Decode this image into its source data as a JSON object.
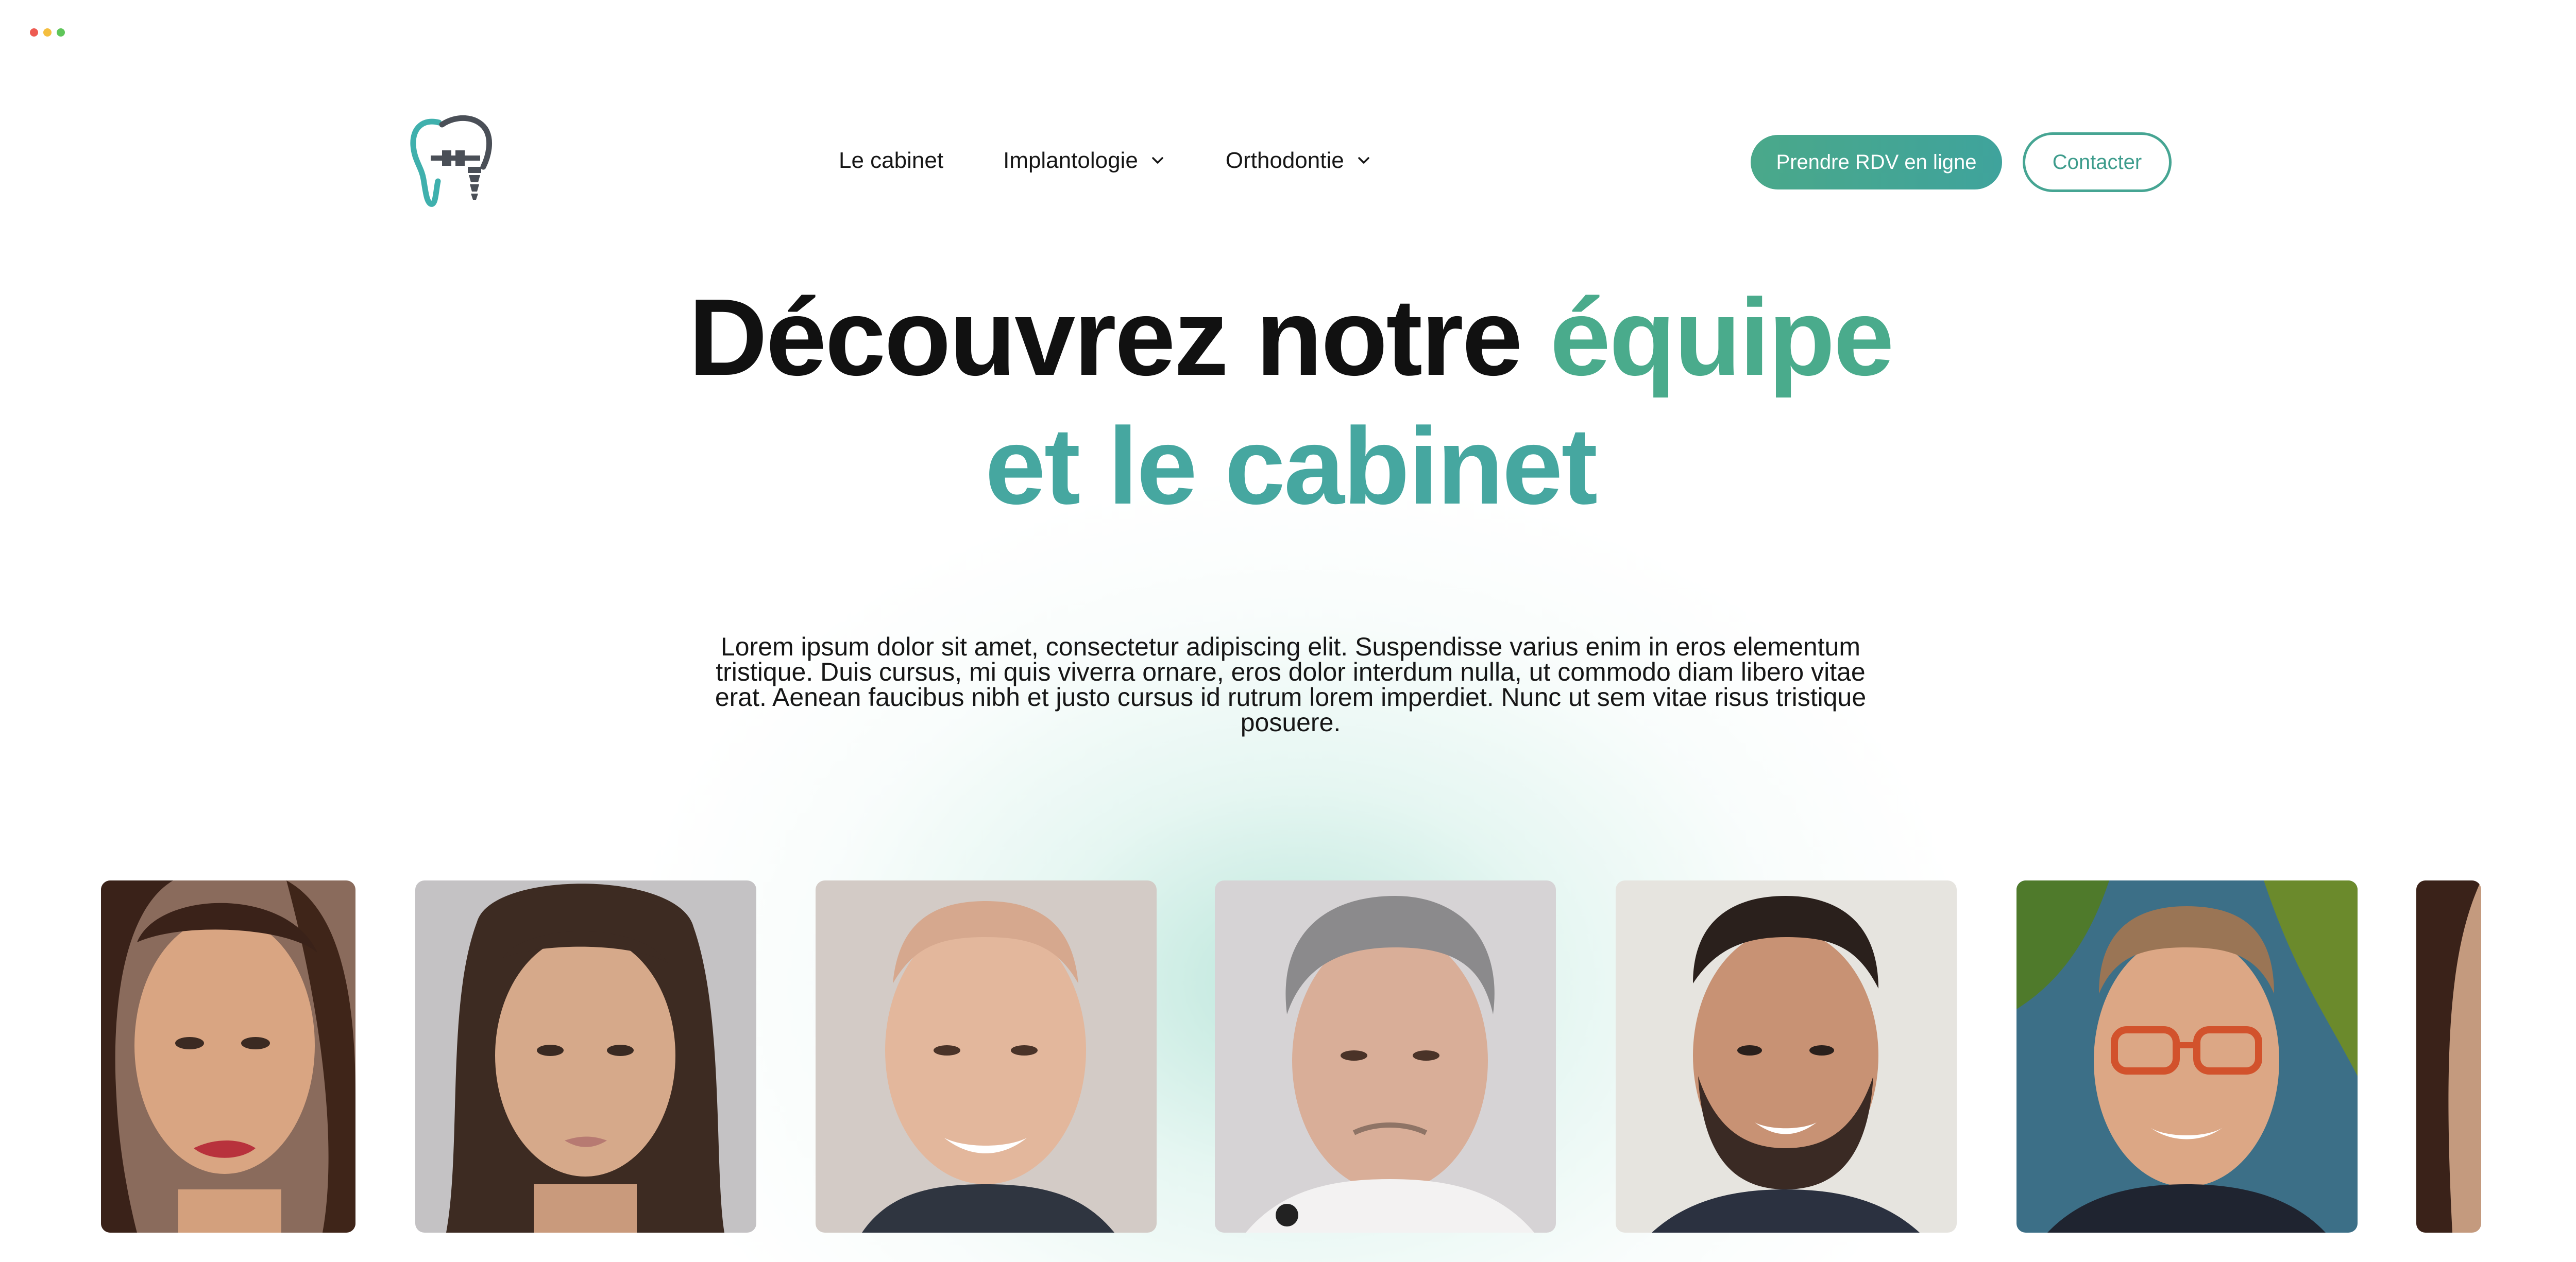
{
  "window": {
    "dots": [
      "#ee5b52",
      "#f4be3f",
      "#5fc65a"
    ]
  },
  "brand": {
    "logo_icon": "tooth-implant-logo-icon",
    "colors": {
      "green": "#4aab8c",
      "teal": "#46a7a0",
      "text": "#111111"
    }
  },
  "nav": {
    "items": [
      {
        "label": "Le cabinet",
        "has_dropdown": false
      },
      {
        "label": "Implantologie",
        "has_dropdown": true,
        "icon": "chevron-down-icon"
      },
      {
        "label": "Orthodontie",
        "has_dropdown": true,
        "icon": "chevron-down-icon"
      }
    ],
    "cta_primary": "Prendre RDV en ligne",
    "cta_secondary": "Contacter"
  },
  "hero": {
    "title_part1": "Découvrez notre ",
    "title_highlight1": "équipe",
    "title_line2": "et le cabinet",
    "lead": "Lorem ipsum dolor sit amet, consectetur adipiscing elit. Suspendisse varius enim in eros elementum tristique. Duis cursus, mi quis viverra ornare, eros dolor interdum nulla, ut commodo diam libero vitae erat. Aenean faucibus nibh et justo cursus id rutrum lorem imperdiet. Nunc ut sem vitae risus tristique posuere."
  },
  "team": {
    "photos": [
      {
        "name": "woman-smiling-photo",
        "partial": true
      },
      {
        "name": "woman-curly-hair-photo",
        "partial": false
      },
      {
        "name": "man-bald-photo",
        "partial": false
      },
      {
        "name": "man-gray-hair-photo",
        "partial": false
      },
      {
        "name": "man-beard-photo",
        "partial": false
      },
      {
        "name": "man-glasses-photo",
        "partial": false
      },
      {
        "name": "woman-partial-photo",
        "partial": true
      }
    ]
  }
}
